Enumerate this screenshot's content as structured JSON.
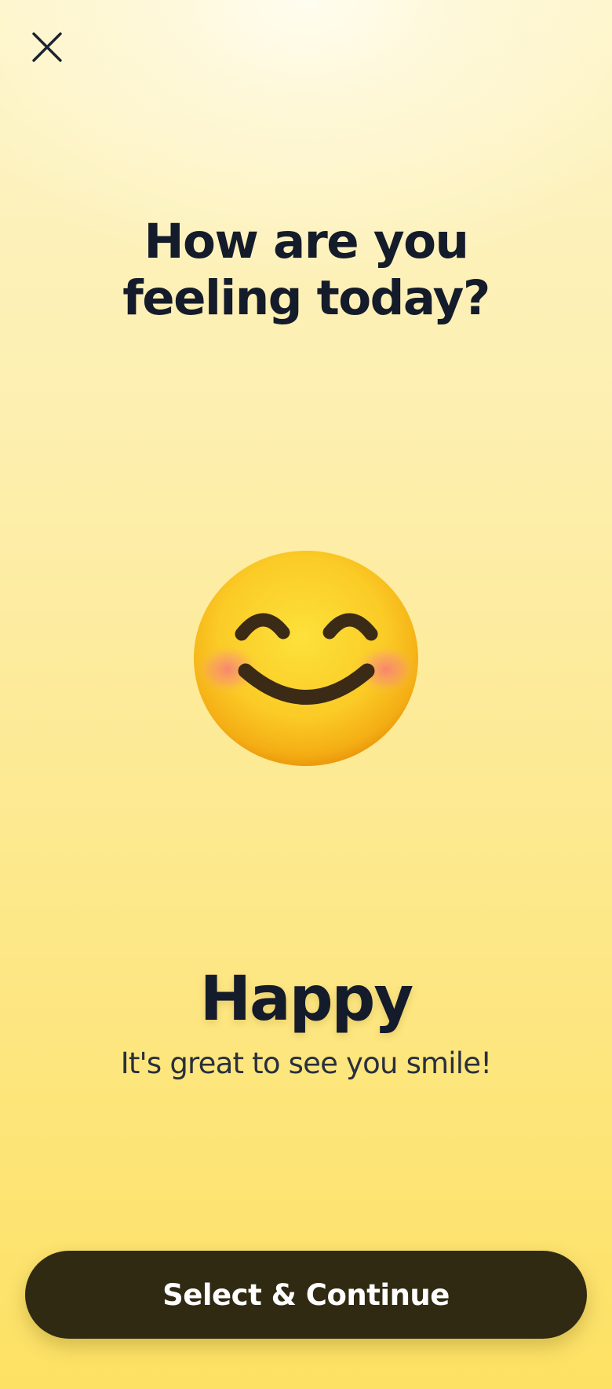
{
  "header": {
    "close_icon": "close-icon"
  },
  "main": {
    "question": "How are you feeling today?",
    "mood": {
      "emoji_icon": "smiling-face-with-smiling-eyes-icon",
      "label": "Happy",
      "message": "It's great to see you smile!"
    }
  },
  "footer": {
    "continue_label": "Select & Continue"
  },
  "colors": {
    "background_top": "#FDF4C6",
    "background_bottom": "#FDE164",
    "text_primary": "#141B2A",
    "button_background": "#312A12",
    "button_text": "#FFFFFF"
  }
}
